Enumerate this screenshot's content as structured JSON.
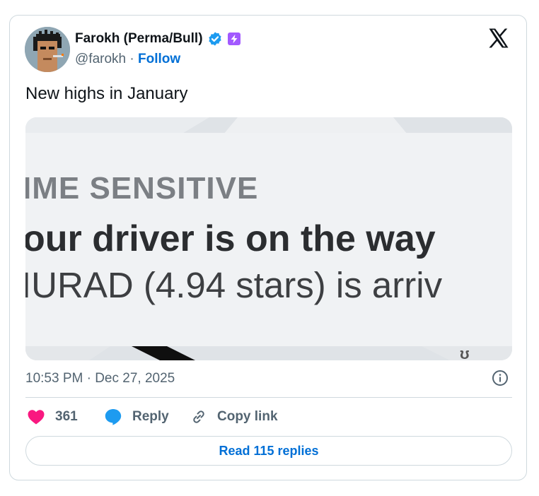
{
  "author": {
    "name": "Farokh (Perma/Bull)",
    "handle": "@farokh",
    "separator": "·",
    "follow_label": "Follow",
    "icons": [
      "verified-badge-icon",
      "affiliate-badge-icon"
    ]
  },
  "header_icon": "x-logo-icon",
  "tweet": {
    "text": "New highs in January"
  },
  "media": {
    "line1": "IME SENSITIVE",
    "line2": "our driver is on the way",
    "line3": "IURAD (4.94 stars) is arriv"
  },
  "meta": {
    "timestamp": "10:53 PM · Dec 27, 2025",
    "info_icon": "info-icon"
  },
  "actions": {
    "like_count": "361",
    "reply_label": "Reply",
    "copy_link_label": "Copy link"
  },
  "read_replies_label": "Read 115 replies",
  "colors": {
    "accent": "#006fd6",
    "like": "#f91880",
    "reply_icon": "#1d9bf0",
    "verified": "#1d9bf0",
    "badge": "#a259ff",
    "muted": "#536471",
    "border": "#cfd9de"
  }
}
